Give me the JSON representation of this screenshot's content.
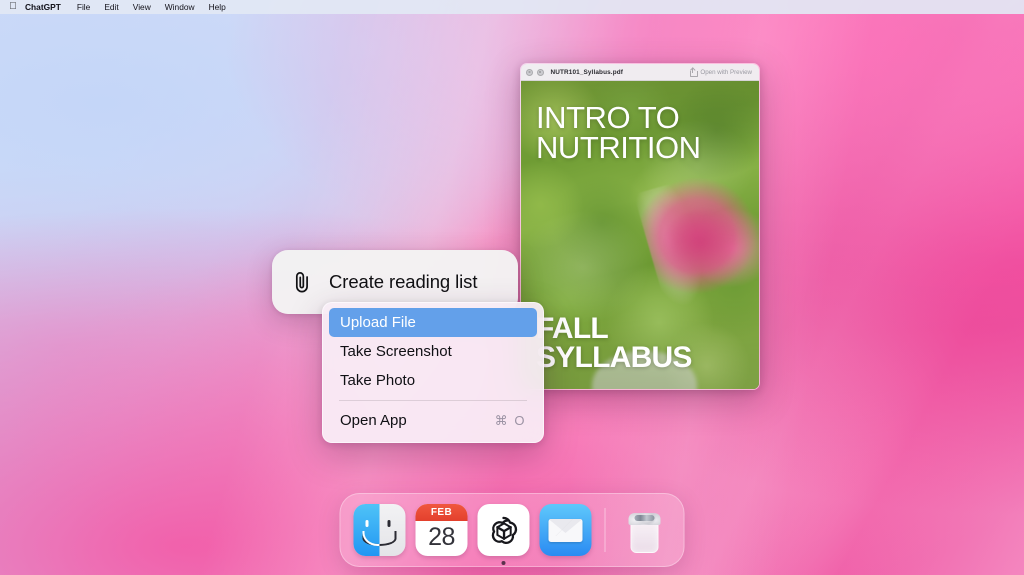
{
  "menubar": {
    "apple_icon": "apple-logo-icon",
    "items": [
      {
        "label": "ChatGPT",
        "bold": true
      },
      {
        "label": "File",
        "bold": false
      },
      {
        "label": "Edit",
        "bold": false
      },
      {
        "label": "View",
        "bold": false
      },
      {
        "label": "Window",
        "bold": false
      },
      {
        "label": "Help",
        "bold": false
      }
    ]
  },
  "quicklook": {
    "filename": "NUTR101_Syllabus.pdf",
    "open_with_label": "Open with Preview",
    "share_icon": "share-icon",
    "window_controls": [
      "close-button",
      "minimize-button"
    ],
    "document": {
      "title_line1": "INTRO TO",
      "title_line2": "NUTRITION",
      "footer_line1": "FALL",
      "footer_line2": "SYLLABUS"
    }
  },
  "command_pill": {
    "icon": "paperclip-icon",
    "label": "Create reading list"
  },
  "context_menu": {
    "items": [
      {
        "label": "Upload File",
        "shortcut": "",
        "selected": true,
        "separator_after": false
      },
      {
        "label": "Take Screenshot",
        "shortcut": "",
        "selected": false,
        "separator_after": false
      },
      {
        "label": "Take Photo",
        "shortcut": "",
        "selected": false,
        "separator_after": true
      },
      {
        "label": "Open App",
        "shortcut": "⌘ O",
        "selected": false,
        "separator_after": false
      }
    ],
    "highlight_color": "#63a0ea"
  },
  "dock": {
    "items": [
      {
        "name": "finder",
        "label": "Finder",
        "running": false
      },
      {
        "name": "calendar",
        "label": "Calendar",
        "month": "FEB",
        "day": "28",
        "running": false
      },
      {
        "name": "chatgpt",
        "label": "ChatGPT",
        "running": true
      },
      {
        "name": "mail",
        "label": "Mail",
        "running": false
      },
      {
        "name": "trash",
        "label": "Trash",
        "running": false
      }
    ]
  },
  "colors": {
    "menubar_bg": "#e2e8f4",
    "menu_highlight": "#63a0ea",
    "calendar_red": "#e3402c",
    "mail_blue": "#2a8bf2",
    "finder_blue": "#2196f3"
  }
}
